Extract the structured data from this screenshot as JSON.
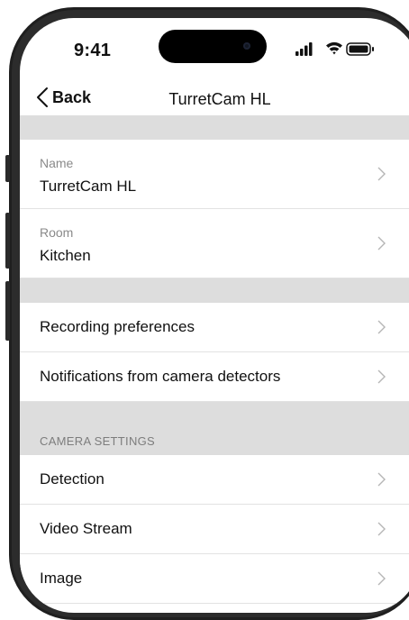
{
  "status_bar": {
    "time": "9:41"
  },
  "nav": {
    "back_label": "Back",
    "title": "TurretCam HL"
  },
  "device": {
    "name_label": "Name",
    "name_value": "TurretCam HL",
    "room_label": "Room",
    "room_value": "Kitchen"
  },
  "menu": {
    "recording": "Recording preferences",
    "notifications": "Notifications from camera detectors"
  },
  "camera_settings": {
    "header": "CAMERA SETTINGS",
    "detection": "Detection",
    "video_stream": "Video Stream",
    "image": "Image"
  },
  "colors": {
    "section_gap": "#dddddd",
    "text_primary": "#111111",
    "text_secondary": "#8a8a8a",
    "chevron": "#b5b5b5"
  }
}
